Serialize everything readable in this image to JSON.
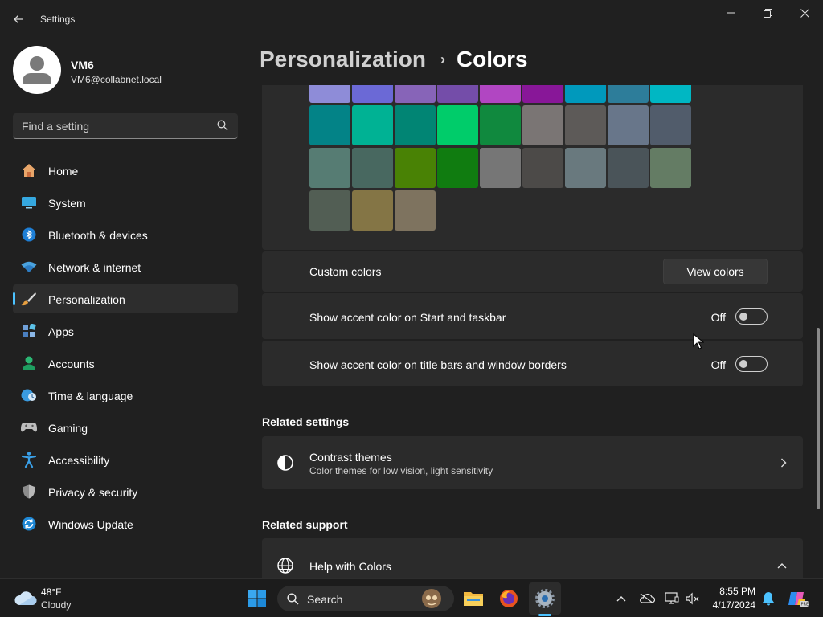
{
  "window": {
    "title": "Settings",
    "back_icon": "back-arrow-icon",
    "minimize_icon": "minimize-icon",
    "restore_icon": "restore-icon",
    "close_icon": "close-icon"
  },
  "profile": {
    "name": "VM6",
    "email": "VM6@collabnet.local"
  },
  "search": {
    "placeholder": "Find a setting"
  },
  "sidebar": {
    "items": [
      {
        "label": "Home",
        "icon": "home-icon"
      },
      {
        "label": "System",
        "icon": "system-icon"
      },
      {
        "label": "Bluetooth & devices",
        "icon": "bluetooth-icon"
      },
      {
        "label": "Network & internet",
        "icon": "wifi-icon"
      },
      {
        "label": "Personalization",
        "icon": "brush-icon",
        "selected": true
      },
      {
        "label": "Apps",
        "icon": "apps-icon"
      },
      {
        "label": "Accounts",
        "icon": "accounts-icon"
      },
      {
        "label": "Time & language",
        "icon": "time-language-icon"
      },
      {
        "label": "Gaming",
        "icon": "gaming-icon"
      },
      {
        "label": "Accessibility",
        "icon": "accessibility-icon"
      },
      {
        "label": "Privacy & security",
        "icon": "shield-icon"
      },
      {
        "label": "Windows Update",
        "icon": "windows-update-icon"
      }
    ]
  },
  "breadcrumb": {
    "parent": "Personalization",
    "separator": "›",
    "current": "Colors"
  },
  "accent_palette": {
    "rows": [
      [
        "#8e8cd8",
        "#6b69d6",
        "#8764b8",
        "#744da9",
        "#b146c2",
        "#881798",
        "#0099bc",
        "#2d7d9a",
        "#00b7c3"
      ],
      [
        "#038387",
        "#00b294",
        "#018574",
        "#00cc6a",
        "#10893e",
        "#7a7574",
        "#5d5a58",
        "#68768a",
        "#515c6b"
      ],
      [
        "#567c73",
        "#486860",
        "#498205",
        "#107c10",
        "#767676",
        "#4c4a48",
        "#69797e",
        "#4a5459",
        "#647c64"
      ],
      [
        "#525e54",
        "#847545",
        "#7e735f"
      ]
    ]
  },
  "settings": {
    "custom_colors_label": "Custom colors",
    "view_colors_button": "View colors",
    "accent_start_label": "Show accent color on Start and taskbar",
    "accent_start_state": "Off",
    "accent_title_label": "Show accent color on title bars and window borders",
    "accent_title_state": "Off"
  },
  "related_settings": {
    "heading": "Related settings",
    "contrast_title": "Contrast themes",
    "contrast_desc": "Color themes for low vision, light sensitivity",
    "contrast_icon": "contrast-icon",
    "chevron_icon": "chevron-right-icon"
  },
  "related_support": {
    "heading": "Related support",
    "help_title": "Help with Colors",
    "help_icon": "globe-icon",
    "chevron_icon": "chevron-up-icon"
  },
  "taskbar": {
    "weather_temp": "48°F",
    "weather_condition": "Cloudy",
    "search_label": "Search",
    "time": "8:55 PM",
    "date": "4/17/2024",
    "apps": [
      "start-icon",
      "search-icon",
      "file-explorer-icon",
      "firefox-icon",
      "settings-icon"
    ],
    "tray": [
      "chevron-up-icon",
      "onedrive-off-icon",
      "display-icon",
      "volume-muted-icon",
      "notification-bell-icon",
      "copilot-icon"
    ]
  },
  "colors": {
    "accent": "#4cc2ff",
    "background": "#202020",
    "card": "#2b2b2b"
  }
}
